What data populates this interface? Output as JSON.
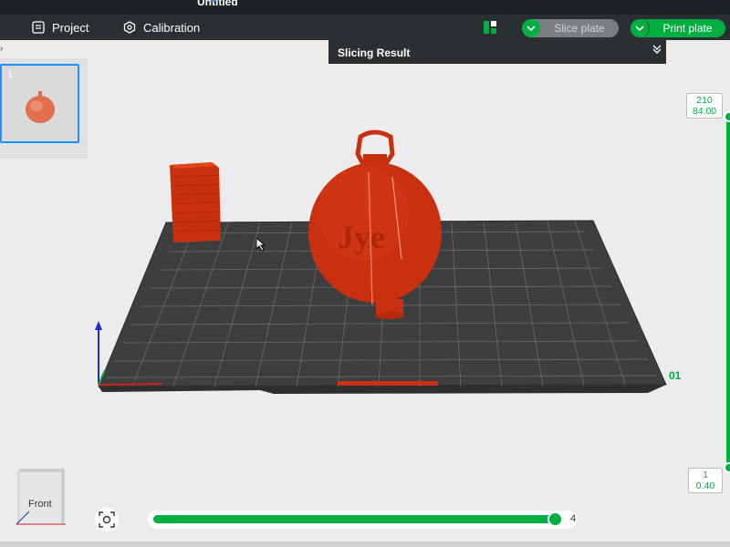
{
  "window": {
    "title": "Untitled"
  },
  "toolbar": {
    "project_label": "Project",
    "calibration_label": "Calibration",
    "slice_label": "Slice plate",
    "print_label": "Print plate"
  },
  "plates": [
    {
      "index": "1"
    }
  ],
  "slicing_result": {
    "title": "Slicing Result"
  },
  "layer_slider": {
    "top_layer": "210",
    "top_height": "84.00",
    "bottom_layer": "1",
    "bottom_height": "0.40"
  },
  "move_slider": {
    "value": "4",
    "position_fraction": 0.98
  },
  "view": {
    "current": "Front"
  },
  "colors": {
    "accent": "#00ae42",
    "model": "#d43c14",
    "bed": "#3c3e40",
    "toolbar": "#2a2f33",
    "selection": "#1e90ff"
  },
  "icons": {
    "project": "project-icon",
    "calibration": "calibration-icon",
    "layout": "layout-icon",
    "dropdown": "chevron-down-icon",
    "collapse": "double-chevron-down-icon",
    "fit_view": "fit-view-icon"
  }
}
